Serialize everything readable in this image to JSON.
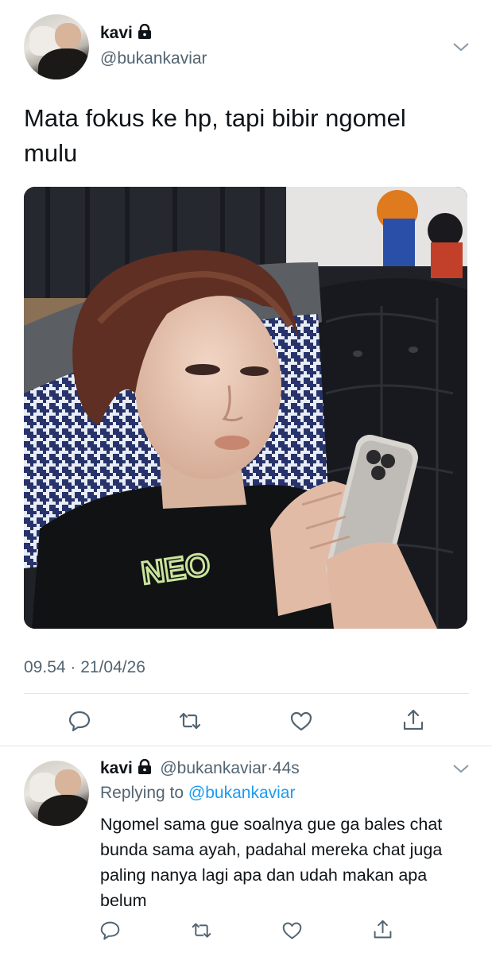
{
  "tweet": {
    "display_name": "kavi",
    "handle": "@bukankaviar",
    "protected_icon": "lock-icon",
    "text": "Mata fokus ke hp, tapi bibir ngomel mulu",
    "timestamp": "09.54 · 21/04/26",
    "menu_icon": "chevron-down-icon",
    "actions": [
      "reply-icon",
      "retweet-icon",
      "like-icon",
      "share-icon"
    ]
  },
  "reply": {
    "display_name": "kavi",
    "handle": "@bukankaviar",
    "separator": "·",
    "time_ago": "44s",
    "replying_prefix": "Replying to",
    "replying_handle": "@bukankaviar",
    "text": "Ngomel sama gue soalnya gue ga bales chat bunda sama ayah, padahal mereka chat juga paling nanya lagi apa dan udah makan apa belum",
    "menu_icon": "chevron-down-icon",
    "actions": [
      "reply-icon",
      "retweet-icon",
      "like-icon",
      "share-icon"
    ]
  },
  "colors": {
    "text_primary": "#0f1419",
    "text_secondary": "#536471",
    "link": "#1d9bf0",
    "divider": "#e1e6ea"
  }
}
